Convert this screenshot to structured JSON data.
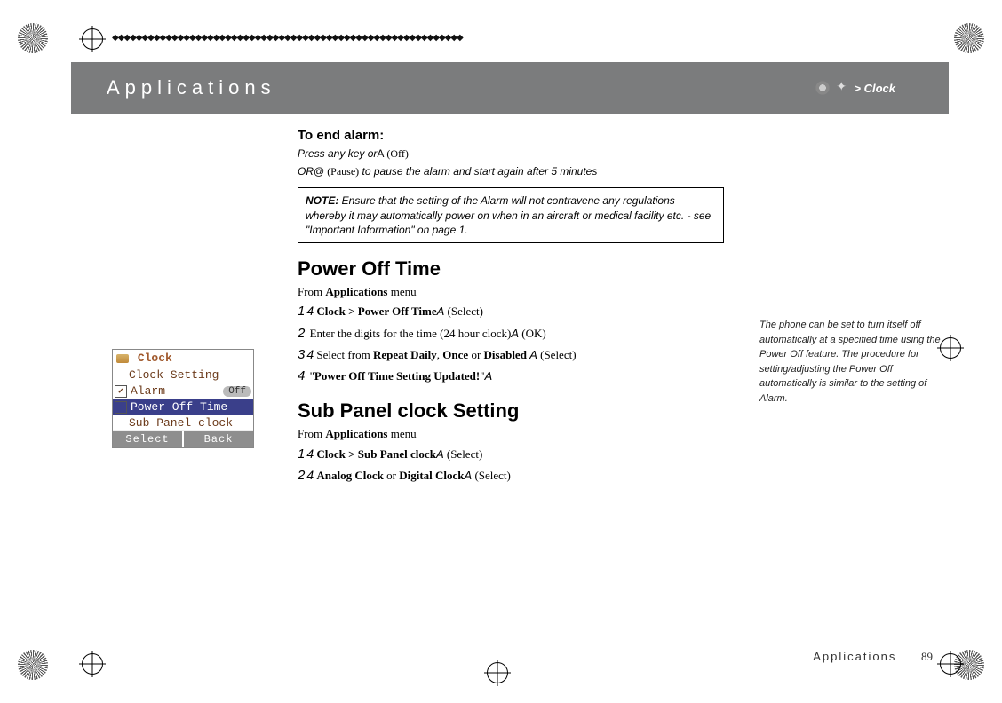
{
  "header": {
    "title": "Applications",
    "breadcrumb": " > Clock"
  },
  "phone": {
    "title": "Clock",
    "rows": [
      {
        "label": "Clock Setting",
        "checkbox": false,
        "checked": false,
        "badge": "",
        "selected": false
      },
      {
        "label": "Alarm",
        "checkbox": true,
        "checked": true,
        "badge": "Off",
        "selected": false
      },
      {
        "label": "Power Off Time",
        "checkbox": true,
        "checked": false,
        "badge": "",
        "selected": true
      },
      {
        "label": "Sub Panel clock",
        "checkbox": false,
        "checked": false,
        "badge": "",
        "selected": false
      }
    ],
    "soft_left": "Select",
    "soft_right": "Back"
  },
  "content": {
    "end_alarm": {
      "heading": "To end alarm:",
      "line1_a": "Press any key or",
      "line1_key": "A",
      "line1_b": " (Off)",
      "line2_a": "OR",
      "line2_key": "@",
      "line2_b": " (Pause)",
      "line2_c": " to pause the alarm and start again after 5 minutes"
    },
    "note": {
      "label": "NOTE:",
      "text": " Ensure that the setting of the Alarm will not contravene any regulations whereby it may automatically power on when in an aircraft or medical facility etc. - see \"Important Information\" on page 1."
    },
    "power_off": {
      "heading": "Power Off Time",
      "from": "From ",
      "from_bold": "Applications",
      "from_suffix": " menu",
      "steps": [
        {
          "num": "1",
          "arrow": "4",
          "pre": "",
          "bold": "Clock > Power Off Time",
          "key": "A",
          "suffix": " (Select)"
        },
        {
          "num": "2",
          "arrow": "",
          "pre": " Enter the digits for the time (24 hour clock)",
          "bold": "",
          "key": "A",
          "suffix": " (OK)"
        },
        {
          "num": "3",
          "arrow": "4",
          "pre": " Select from ",
          "bold": "Repeat Daily",
          "mid": ", ",
          "bold2": "Once",
          "mid2": " or ",
          "bold3": "Disabled ",
          "key": "A",
          "suffix": " (Select)"
        },
        {
          "num": "4",
          "arrow": "",
          "pre": " \"",
          "bold": "Power Off Time Setting Updated!",
          "post": "\"",
          "key": "A",
          "suffix": ""
        }
      ]
    },
    "sub_panel": {
      "heading": "Sub Panel clock Setting",
      "from": "From ",
      "from_bold": "Applications",
      "from_suffix": " menu",
      "steps": [
        {
          "num": "1",
          "arrow": "4",
          "pre": "",
          "bold": "Clock > Sub Panel clock",
          "key": "A",
          "suffix": " (Select)"
        },
        {
          "num": "2",
          "arrow": "4",
          "pre": "",
          "bold": "Analog Clock",
          "mid": " or ",
          "bold2": "Digital Clock",
          "key": "A",
          "suffix": " (Select)"
        }
      ]
    }
  },
  "sidenote": "The phone can be set to turn itself off automatically at a specified time using the Power Off feature. The procedure for setting/adjusting the Power Off automatically is similar to the setting of Alarm.",
  "footer": {
    "section": "Applications",
    "page": "89"
  }
}
